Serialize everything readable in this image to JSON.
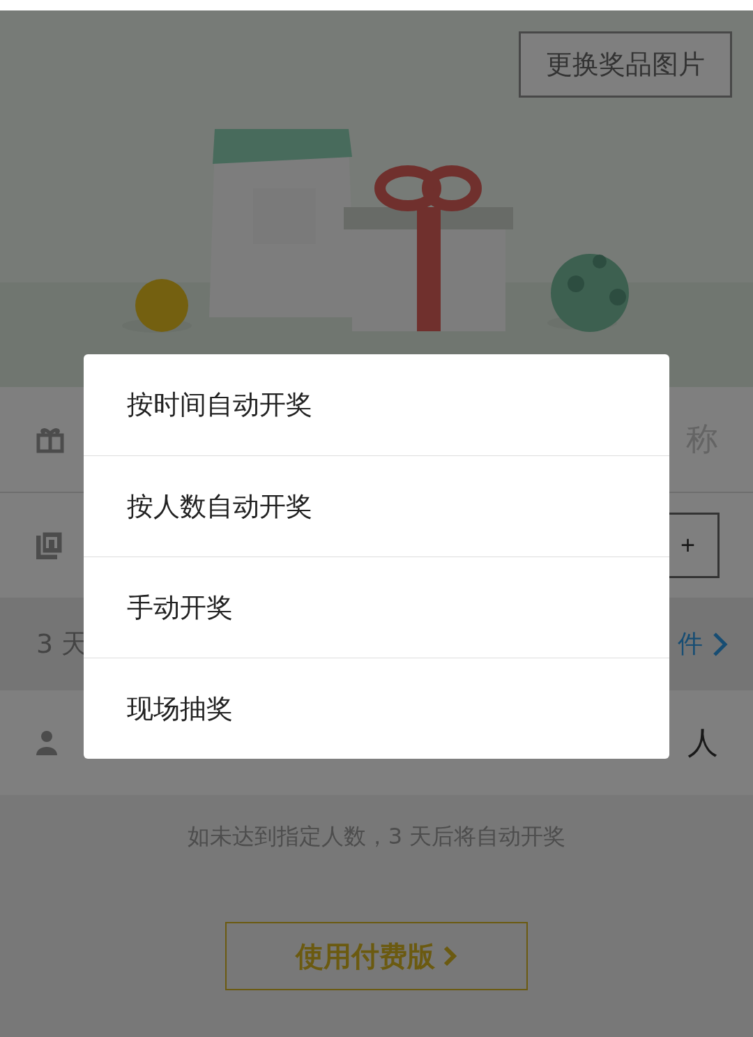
{
  "banner": {
    "change_image_button": "更换奖品图片"
  },
  "form": {
    "prize_name_placeholder": "称",
    "quantity_increment": "+",
    "duration_row": {
      "value": "3 天",
      "link": "件"
    },
    "participants_row": {
      "unit": "人"
    }
  },
  "hint": "如未达到指定人数，3 天后将自动开奖",
  "upgrade_button": "使用付费版",
  "dialog": {
    "options": [
      {
        "label": "按时间自动开奖"
      },
      {
        "label": "按人数自动开奖"
      },
      {
        "label": "手动开奖"
      },
      {
        "label": "现场抽奖"
      }
    ]
  }
}
